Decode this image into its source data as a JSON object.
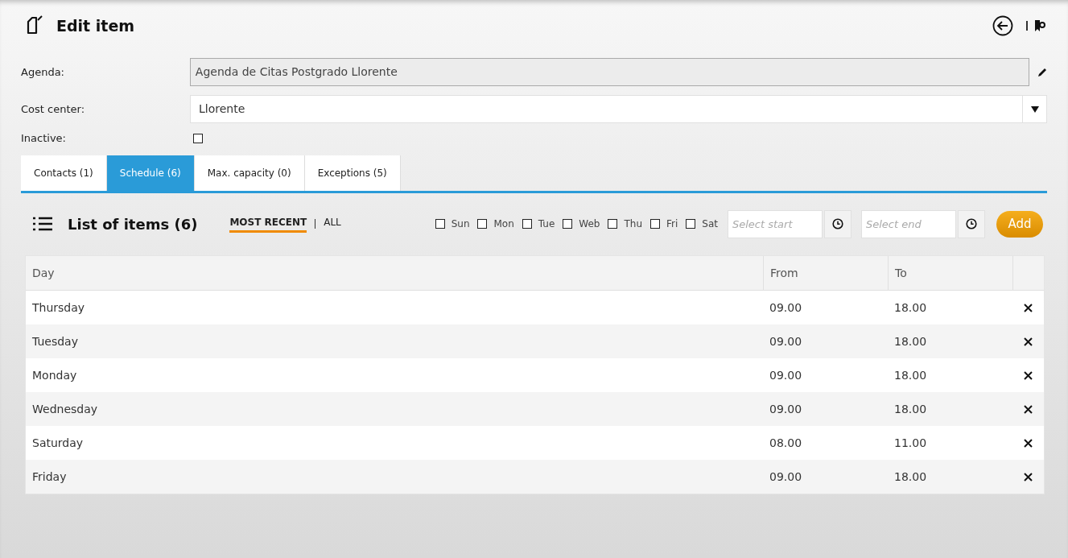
{
  "header": {
    "title": "Edit item"
  },
  "form": {
    "agenda": {
      "label": "Agenda:",
      "value": "Agenda de Citas Postgrado Llorente"
    },
    "cost_center": {
      "label": "Cost center:",
      "value": "Llorente"
    },
    "inactive": {
      "label": "Inactive:",
      "checked": false
    }
  },
  "tabs": [
    {
      "label": "Contacts (1)",
      "selected": false
    },
    {
      "label": "Schedule (6)",
      "selected": true
    },
    {
      "label": "Max. capacity (0)",
      "selected": false
    },
    {
      "label": "Exceptions (5)",
      "selected": false
    }
  ],
  "list": {
    "title": "List of items (6)",
    "filters": [
      {
        "label": "MOST RECENT",
        "selected": true
      },
      {
        "label": "ALL",
        "selected": false
      }
    ],
    "days": [
      {
        "label": "Sun",
        "checked": false
      },
      {
        "label": "Mon",
        "checked": false
      },
      {
        "label": "Tue",
        "checked": false
      },
      {
        "label": "Web",
        "checked": false
      },
      {
        "label": "Thu",
        "checked": false
      },
      {
        "label": "Fri",
        "checked": false
      },
      {
        "label": "Sat",
        "checked": false
      }
    ],
    "start": {
      "placeholder": "Select start"
    },
    "end": {
      "placeholder": "Select end"
    },
    "add_button": "Add"
  },
  "table": {
    "columns": [
      "Day",
      "From",
      "To"
    ],
    "rows": [
      [
        "Thursday",
        "09.00",
        "18.00"
      ],
      [
        "Tuesday",
        "09.00",
        "18.00"
      ],
      [
        "Monday",
        "09.00",
        "18.00"
      ],
      [
        "Wednesday",
        "09.00",
        "18.00"
      ],
      [
        "Saturday",
        "08.00",
        "11.00"
      ],
      [
        "Friday",
        "09.00",
        "18.00"
      ]
    ]
  }
}
